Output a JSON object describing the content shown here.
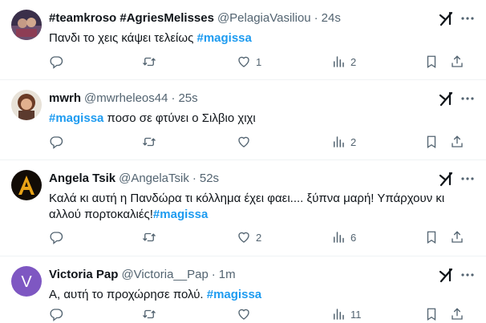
{
  "tweets": [
    {
      "name": "#teamkroso #AgriesMelisses",
      "handle": "@PelagiaVasiliou",
      "time": "24s",
      "text_before": "Πανδι το χεις κάψει τελείως ",
      "hashtag": "#magissa",
      "text_after": "",
      "replies": "",
      "retweets": "",
      "likes": "1",
      "views": "2"
    },
    {
      "name": "mwrh",
      "handle": "@mwrheleos44",
      "time": "25s",
      "text_before": "",
      "hashtag": "#magissa",
      "text_after": " ποσο σε φτύνει ο Σιλβιο χιχι",
      "replies": "",
      "retweets": "",
      "likes": "",
      "views": "2"
    },
    {
      "name": "Angela Tsik",
      "handle": "@AngelaTsik",
      "time": "52s",
      "text_before": "Καλά κι αυτή η Πανδώρα τι κόλλημα έχει φαει.... ξύπνα μαρή! Υπάρχουν κι αλλού πορτοκαλιές!",
      "hashtag": "#magissa",
      "text_after": "",
      "replies": "",
      "retweets": "",
      "likes": "2",
      "views": "6"
    },
    {
      "name": "Victoria Pap",
      "handle": "@Victoria__Pap",
      "time": "1m",
      "avatar_letter": "V",
      "text_before": "Α, αυτή το προχώρησε πολύ. ",
      "hashtag": "#magissa",
      "text_after": "",
      "replies": "",
      "retweets": "",
      "likes": "",
      "views": "11"
    }
  ],
  "colors": {
    "hashtag": "#1d9bf0",
    "muted": "#536471",
    "text": "#0f1419",
    "divider": "#eff3f4",
    "avatar_v": "#7e57c2"
  },
  "icons": [
    "reply-icon",
    "retweet-icon",
    "like-icon",
    "views-icon",
    "bookmark-icon",
    "share-icon",
    "grok-icon",
    "more-icon"
  ]
}
